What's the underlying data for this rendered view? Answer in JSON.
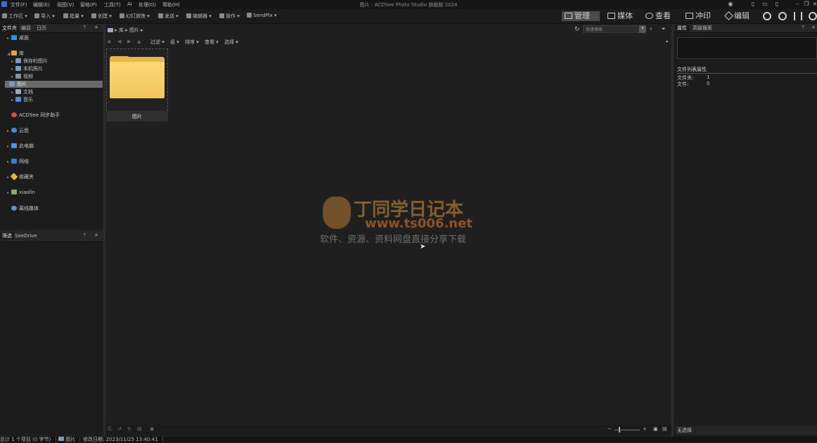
{
  "window": {
    "title": "图片 - ACDSee Photo Studio 旗舰版 2024",
    "menu": [
      "文件(F)",
      "编辑(E)",
      "视图(V)",
      "窗格(P)",
      "工具(T)",
      "AI",
      "处理(O)",
      "帮助(H)"
    ]
  },
  "toolbar": {
    "items": [
      "工作区",
      "导入",
      "批量",
      "创建",
      "幻灯放映",
      "发送",
      "编辑器",
      "操作",
      "SendPix"
    ]
  },
  "modes": {
    "manage": "管理",
    "media": "媒体",
    "view": "查看",
    "develop": "冲印",
    "edit": "编辑"
  },
  "folder_panel": {
    "tabs": [
      "文件夹",
      "编目",
      "日历"
    ],
    "pin": "ᛘ",
    "close": "×",
    "tree": [
      "桌面",
      "库",
      "保存的图片",
      "本机照片",
      "视频",
      "图片",
      "文档",
      "音乐",
      "ACDSee 同步助手",
      "云盘",
      "此电脑",
      "网络",
      "收藏夹",
      "xiaolin",
      "离线媒体"
    ]
  },
  "bottom_left_panel": {
    "tabs": [
      "筛选",
      "SeeDrive"
    ]
  },
  "address": {
    "crumbs": [
      "库",
      "图片"
    ],
    "search_placeholder": "快速搜索"
  },
  "filterbar": {
    "items": [
      "过滤",
      "组",
      "排序",
      "查看",
      "选择"
    ]
  },
  "content": {
    "thumbnail_label": "图片"
  },
  "watermark": {
    "title": "丁同学日记本",
    "url": "www.ts006.net",
    "subtitle": "软件、资源、资料网盘直接分享下载"
  },
  "properties_panel": {
    "tabs": [
      "属性",
      "高级搜索"
    ],
    "section": "文件列表属性",
    "rows": [
      {
        "label": "文件夹:",
        "value": "1"
      },
      {
        "label": "文件:",
        "value": "0"
      }
    ],
    "footer": "无选择"
  },
  "statusbar": {
    "total": "总计 1 个项目 (0 字节)",
    "selected": "图片",
    "modified": "修改日期: 2023/11/25 13:40:41"
  },
  "colors": {
    "background": "#1f1f1f",
    "folder": "#f1c55a",
    "watermark_orange": "#c68436",
    "selection": "#6a6a6a"
  }
}
